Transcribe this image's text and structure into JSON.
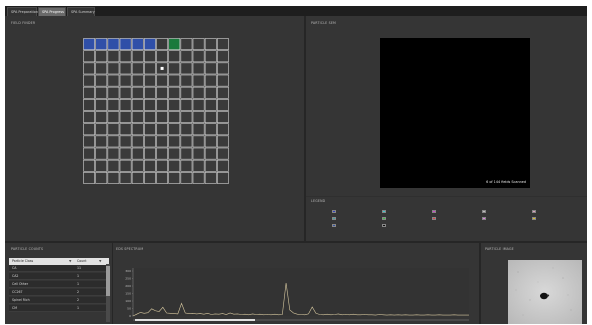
{
  "tabs": [
    {
      "label": "SPA Preparation",
      "active": false
    },
    {
      "label": "SPA Progress",
      "active": true
    },
    {
      "label": "SPA Summary",
      "active": false
    }
  ],
  "panels": {
    "field_finder": {
      "title": "FIELD FINDER"
    },
    "particle_sem": {
      "title": "PARTICLE SEM",
      "status": "6 of 144 fields Scanned"
    },
    "legend": {
      "title": "LEGEND"
    },
    "particle_counts": {
      "title": "PARTICLE COUNTS"
    },
    "eds_spectrum": {
      "title": "EDS SPECTRUM"
    },
    "particle_image": {
      "title": "PARTICLE IMAGE"
    }
  },
  "field_grid": {
    "columns": 12,
    "rows": 12,
    "scanned": 6,
    "current": 7,
    "colors": {
      "scanned": "#2f4fa8",
      "current": "#1a7a3c",
      "empty": "#3a3a3a",
      "line": "#d4d4d4"
    }
  },
  "legend": {
    "items": [
      {
        "label": "",
        "color": "#2f3fc0"
      },
      {
        "label": "",
        "color": "#3ac8d0"
      },
      {
        "label": "",
        "color": "#d040d0"
      },
      {
        "label": "",
        "color": "#c0c0c0"
      },
      {
        "label": "",
        "color": "#e0a0c0"
      },
      {
        "label": "",
        "color": "#40a0a0"
      },
      {
        "label": "",
        "color": "#40c040"
      },
      {
        "label": "",
        "color": "#e04040"
      },
      {
        "label": "",
        "color": "#e080e0"
      },
      {
        "label": "",
        "color": "#e0c020"
      },
      {
        "label": "",
        "color": "#3050a0"
      },
      {
        "label": "",
        "color": "#101010"
      }
    ]
  },
  "particle_counts": {
    "columns": [
      "Particle Class",
      "Count"
    ],
    "rows": [
      {
        "class": "CA",
        "count": "11"
      },
      {
        "class": "CA2",
        "count": "1"
      },
      {
        "class": "Cell Other",
        "count": "1"
      },
      {
        "class": "CC267",
        "count": "2"
      },
      {
        "class": "Spinel Rich",
        "count": "2"
      },
      {
        "class": "CM",
        "count": "1"
      }
    ]
  },
  "chart_data": {
    "type": "line",
    "title": "",
    "xlabel": "",
    "ylabel": "",
    "yticks": [
      "300",
      "250",
      "200",
      "150",
      "100",
      "50",
      "0"
    ],
    "ylim": [
      0,
      320
    ],
    "x": [
      0,
      4,
      8,
      12,
      16,
      20,
      24,
      28,
      32,
      36,
      40,
      44,
      48,
      52,
      56,
      60,
      64,
      68,
      72,
      76,
      80,
      84,
      88,
      92,
      96,
      100,
      104,
      108,
      112,
      116,
      120,
      124,
      128,
      132,
      136,
      140,
      144,
      148,
      152,
      156,
      160,
      164,
      168,
      172,
      176,
      180,
      184,
      188,
      192,
      196,
      200,
      204,
      208,
      212,
      216,
      220,
      224,
      228,
      232,
      236,
      240,
      244,
      248,
      252,
      256,
      260,
      264,
      268,
      272,
      276,
      280,
      284,
      288,
      292,
      296,
      300,
      304,
      308,
      312,
      316,
      320,
      324,
      328,
      332,
      336,
      340,
      344,
      348,
      352,
      356,
      360
    ],
    "series": [
      {
        "values": [
          0,
          12,
          24,
          18,
          22,
          48,
          35,
          30,
          58,
          20,
          18,
          16,
          14,
          84,
          20,
          16,
          18,
          14,
          16,
          12,
          18,
          10,
          14,
          12,
          16,
          10,
          20,
          12,
          14,
          10,
          12,
          8,
          14,
          10,
          12,
          8,
          10,
          8,
          12,
          8,
          10,
          220,
          40,
          20,
          12,
          10,
          8,
          14,
          60,
          18,
          10,
          8,
          12,
          8,
          10,
          14,
          8,
          10,
          8,
          12,
          8,
          8,
          10,
          8,
          8,
          6,
          10,
          8,
          6,
          8,
          6,
          8,
          6,
          8,
          6,
          6,
          8,
          6,
          6,
          8,
          6,
          6,
          8,
          6,
          6,
          6,
          8,
          6,
          6,
          6,
          6
        ]
      }
    ]
  },
  "colors": {
    "spectrum_line": "#d8c9a0",
    "panel_bg": "#353535",
    "tab_active": "#6a6a6a"
  }
}
